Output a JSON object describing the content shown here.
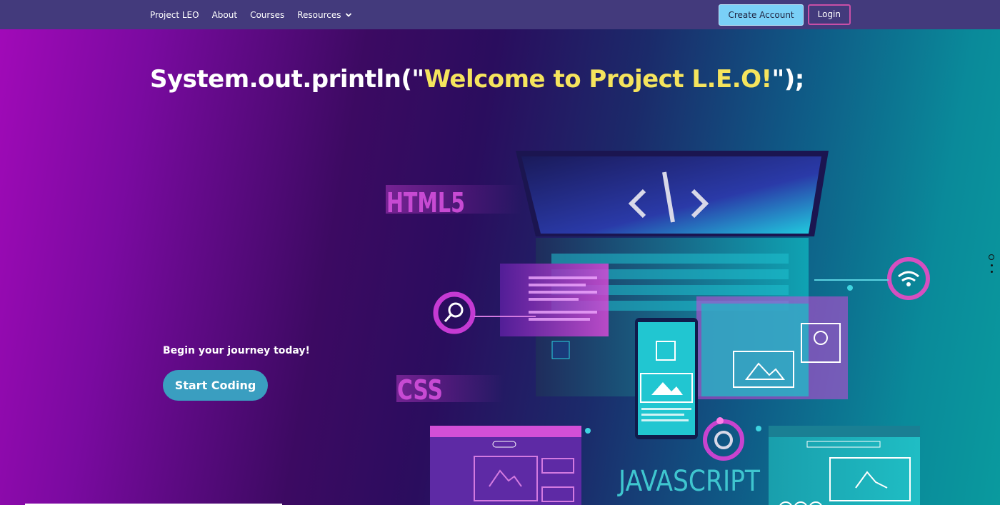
{
  "nav": {
    "links": [
      {
        "label": "Project LEO"
      },
      {
        "label": "About"
      },
      {
        "label": "Courses"
      },
      {
        "label": "Resources"
      }
    ],
    "create_account": "Create Account",
    "login": "Login"
  },
  "hero": {
    "title_prefix": "System.out.println(\"",
    "title_highlight": "Welcome to Project L.E.O!",
    "title_suffix": "\");",
    "tagline": "Begin your journey today!",
    "cta": "Start Coding",
    "art_labels": {
      "html": "HTML5",
      "css": "CSS",
      "js": "JAVASCRIPT"
    }
  },
  "carousel": {
    "slides": 3,
    "active": 0
  },
  "colors": {
    "nav_bg": "#433a7c",
    "highlight": "#f5e45d",
    "cta_bg": "#3a9ec0",
    "create_bg": "#7ad0f7",
    "login_border": "#c94fa7"
  }
}
